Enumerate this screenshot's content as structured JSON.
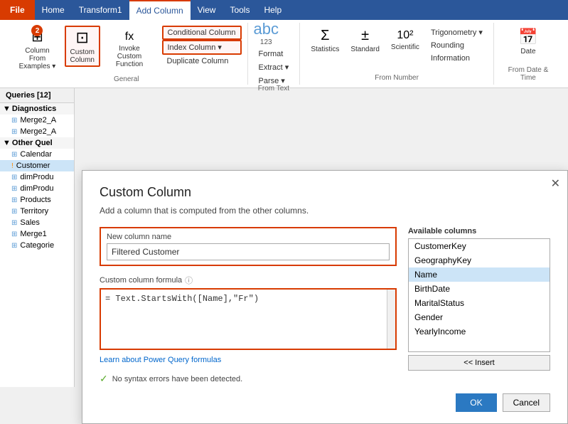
{
  "menuBar": {
    "file": "File",
    "items": [
      "Home",
      "Transform1",
      "Add Column",
      "View",
      "Tools",
      "Help"
    ]
  },
  "ribbon": {
    "activeTab": "Add Column",
    "groups": [
      {
        "name": "General",
        "buttons": [
          {
            "id": "column-from-examples",
            "label": "Column From\nExamples ▾",
            "icon": "⊞",
            "badge": "2"
          },
          {
            "id": "custom-column",
            "label": "Custom\nColumn",
            "icon": "⊡",
            "highlighted": true
          },
          {
            "id": "invoke-custom",
            "label": "Invoke Custom\nFunction",
            "icon": "fx"
          }
        ],
        "smallButtons": [
          {
            "id": "conditional-column",
            "label": "Conditional Column",
            "highlighted": true
          },
          {
            "id": "index-column",
            "label": "Index Column ▾",
            "highlighted": true
          },
          {
            "id": "duplicate-column",
            "label": "Duplicate Column"
          }
        ]
      },
      {
        "name": "From Text",
        "label": "Format",
        "buttons": [],
        "smallButtons": [
          {
            "id": "format",
            "label": "Format"
          },
          {
            "id": "extract",
            "label": "Extract ▾"
          },
          {
            "id": "parse",
            "label": "Parse ▾"
          }
        ]
      },
      {
        "name": "From Number",
        "buttons": [
          {
            "id": "statistics",
            "label": "Statistics",
            "icon": "Σ"
          },
          {
            "id": "standard",
            "label": "Standard",
            "icon": "±"
          },
          {
            "id": "scientific",
            "label": "Scientific",
            "icon": "10²"
          }
        ],
        "smallButtons": [
          {
            "id": "trigonometry",
            "label": "Trigonometry ▾"
          },
          {
            "id": "rounding",
            "label": "Rounding"
          },
          {
            "id": "information",
            "label": "Information"
          }
        ]
      },
      {
        "name": "From Date",
        "buttons": [
          {
            "id": "date-btn",
            "label": "Date",
            "icon": "📅"
          }
        ]
      }
    ]
  },
  "sidebar": {
    "header": "Queries [12]",
    "groups": [
      {
        "name": "Diagnostics",
        "items": [
          {
            "id": "merge2a-1",
            "label": "Merge2_A",
            "type": "table"
          },
          {
            "id": "merge2a-2",
            "label": "Merge2_A",
            "type": "table"
          }
        ]
      },
      {
        "name": "Other Quel",
        "items": [
          {
            "id": "calendar",
            "label": "Calendar",
            "type": "table"
          },
          {
            "id": "customer",
            "label": "Customer",
            "type": "warning",
            "active": true
          },
          {
            "id": "dimprod1",
            "label": "dimProdu",
            "type": "table"
          },
          {
            "id": "dimprod2",
            "label": "dimProdu",
            "type": "table"
          },
          {
            "id": "products",
            "label": "Products",
            "type": "table"
          },
          {
            "id": "territory",
            "label": "Territory",
            "type": "table"
          },
          {
            "id": "sales",
            "label": "Sales",
            "type": "table"
          },
          {
            "id": "merge1",
            "label": "Merge1",
            "type": "table"
          },
          {
            "id": "categories",
            "label": "Categorie",
            "type": "table"
          }
        ]
      }
    ]
  },
  "dialog": {
    "title": "Custom Column",
    "subtitle": "Add a column that is computed from the other columns.",
    "closeLabel": "✕",
    "newColumnNameLabel": "New column name",
    "newColumnNameValue": "Filtered Customer",
    "formulaLabel": "Custom column formula",
    "formulaValue": "= Text.StartsWith([Name],\"Fr\")",
    "availableColumnsLabel": "Available columns",
    "columns": [
      {
        "id": "customerkey",
        "label": "CustomerKey"
      },
      {
        "id": "geographykey",
        "label": "GeographyKey"
      },
      {
        "id": "name",
        "label": "Name",
        "selected": true
      },
      {
        "id": "birthdate",
        "label": "BirthDate"
      },
      {
        "id": "maritalstatus",
        "label": "MaritalStatus"
      },
      {
        "id": "gender",
        "label": "Gender"
      },
      {
        "id": "yearlyincome",
        "label": "YearlyIncome"
      }
    ],
    "insertLabel": "<< Insert",
    "learnLink": "Learn about Power Query formulas",
    "statusIcon": "✓",
    "statusText": "No syntax errors have been detected.",
    "okLabel": "OK",
    "cancelLabel": "Cancel"
  }
}
